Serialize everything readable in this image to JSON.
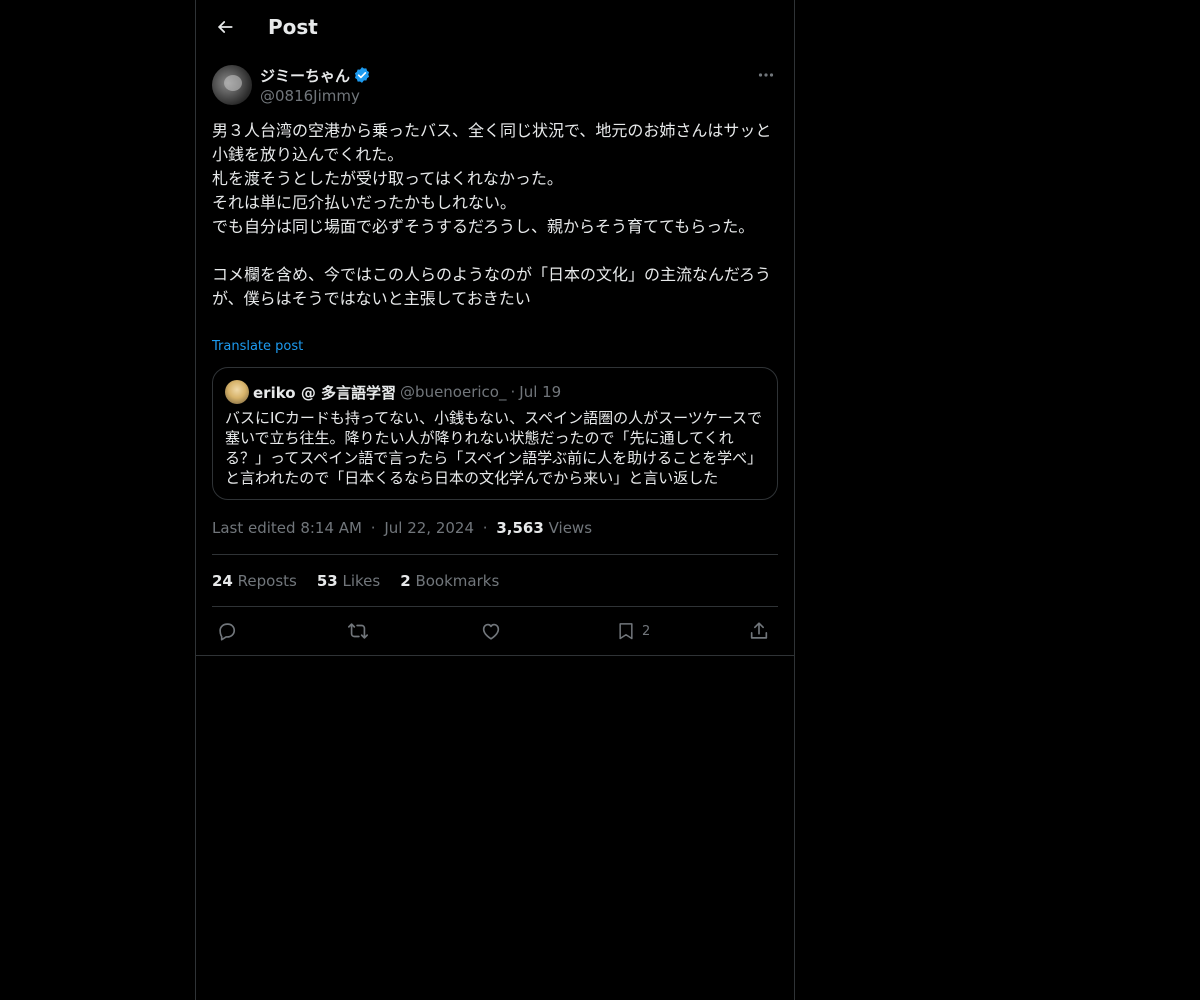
{
  "header": {
    "title": "Post",
    "back_icon": "arrow-left-icon"
  },
  "author": {
    "name": "ジミーちゃん",
    "handle": "@0816Jimmy",
    "verified": true,
    "verified_color": "#1d9bf0"
  },
  "post": {
    "text": "男３人台湾の空港から乗ったバス、全く同じ状況で、地元のお姉さんはサッと小銭を放り込んでくれた。\n札を渡そうとしたが受け取ってはくれなかった。\nそれは単に厄介払いだったかもしれない。\nでも自分は同じ場面で必ずそうするだろうし、親からそう育ててもらった。\n\nコメ欄を含め、今ではこの人らのようなのが「日本の文化」の主流なんだろうが、僕らはそうではないと主張しておきたい",
    "translate_label": "Translate post"
  },
  "quote": {
    "name": "eriko @ 多言語学習",
    "handle": "@buenoerico_",
    "separator": "·",
    "date": "Jul 19",
    "text": "バスにICカードも持ってない、小銭もない、スペイン語圏の人がスーツケースで塞いで立ち往生。降りたい人が降りれない状態だったので「先に通してくれる？」ってスペイン語で言ったら「スペイン語学ぶ前に人を助けることを学べ」と言われたので「日本くるなら日本の文化学んでから来い」と言い返した"
  },
  "meta": {
    "edited": "Last edited 8:14 AM",
    "sep1": "·",
    "date": "Jul 22, 2024",
    "sep2": "·",
    "views_count": "3,563",
    "views_label": "Views"
  },
  "stats": {
    "reposts_count": "24",
    "reposts_label": "Reposts",
    "likes_count": "53",
    "likes_label": "Likes",
    "bookmarks_count": "2",
    "bookmarks_label": "Bookmarks"
  },
  "actions": {
    "reply_icon": "reply-icon",
    "repost_icon": "repost-icon",
    "like_icon": "heart-icon",
    "bookmark_icon": "bookmark-icon",
    "bookmark_count": "2",
    "share_icon": "share-icon"
  },
  "colors": {
    "background": "#000000",
    "text": "#e7e9ea",
    "muted": "#71767b",
    "border": "#2f3336",
    "accent": "#1d9bf0"
  }
}
